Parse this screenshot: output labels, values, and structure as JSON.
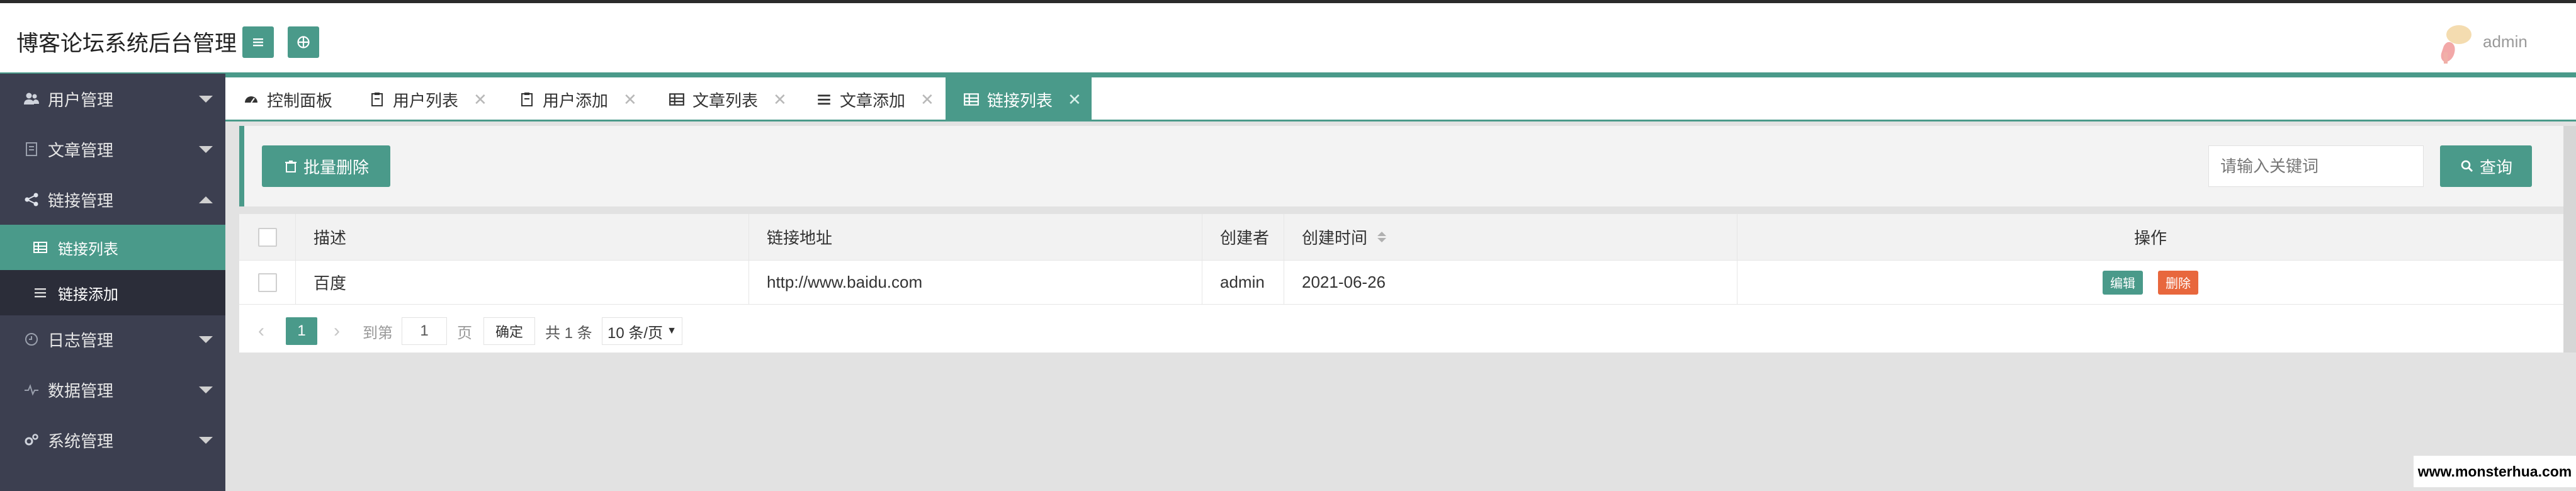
{
  "header": {
    "title": "博客论坛系统后台管理",
    "admin_name": "admin",
    "accent": "#4a9a8a"
  },
  "sidebar": {
    "groups": [
      {
        "label": "用户管理",
        "icon": "users-icon",
        "expanded": false
      },
      {
        "label": "文章管理",
        "icon": "document-icon",
        "expanded": false
      },
      {
        "label": "链接管理",
        "icon": "share-icon",
        "expanded": true
      },
      {
        "label": "日志管理",
        "icon": "clock-icon",
        "expanded": false
      },
      {
        "label": "数据管理",
        "icon": "pulse-icon",
        "expanded": false
      },
      {
        "label": "系统管理",
        "icon": "gears-icon",
        "expanded": false
      }
    ],
    "link_submenu": [
      {
        "label": "链接列表",
        "icon": "table-icon",
        "active": true
      },
      {
        "label": "链接添加",
        "icon": "list-icon",
        "active": false
      }
    ]
  },
  "tabs": [
    {
      "label": "控制面板",
      "icon": "dashboard-icon",
      "closable": false,
      "active": false
    },
    {
      "label": "用户列表",
      "icon": "clipboard-icon",
      "closable": true,
      "active": false
    },
    {
      "label": "用户添加",
      "icon": "clipboard-icon",
      "closable": true,
      "active": false
    },
    {
      "label": "文章列表",
      "icon": "table-icon",
      "closable": true,
      "active": false
    },
    {
      "label": "文章添加",
      "icon": "list-icon",
      "closable": true,
      "active": false
    },
    {
      "label": "链接列表",
      "icon": "table-icon",
      "closable": true,
      "active": true
    }
  ],
  "toolbar": {
    "batch_delete_label": "批量删除",
    "search_placeholder": "请输入关键词",
    "search_button_label": "查询"
  },
  "table": {
    "columns": [
      "描述",
      "链接地址",
      "创建者",
      "创建时间",
      "操作"
    ],
    "rows": [
      {
        "description": "百度",
        "url": "http://www.baidu.com",
        "creator": "admin",
        "created": "2021-06-26"
      }
    ],
    "edit_label": "编辑",
    "delete_label": "删除",
    "edit_color": "#4a9a8a",
    "delete_color": "#e8673d"
  },
  "pagination": {
    "current_page": "1",
    "goto_prefix": "到第",
    "goto_value": "1",
    "goto_suffix": "页",
    "confirm_label": "确定",
    "total_label": "共 1 条",
    "page_size": "10 条/页"
  },
  "watermark": "www.monsterhua.com"
}
